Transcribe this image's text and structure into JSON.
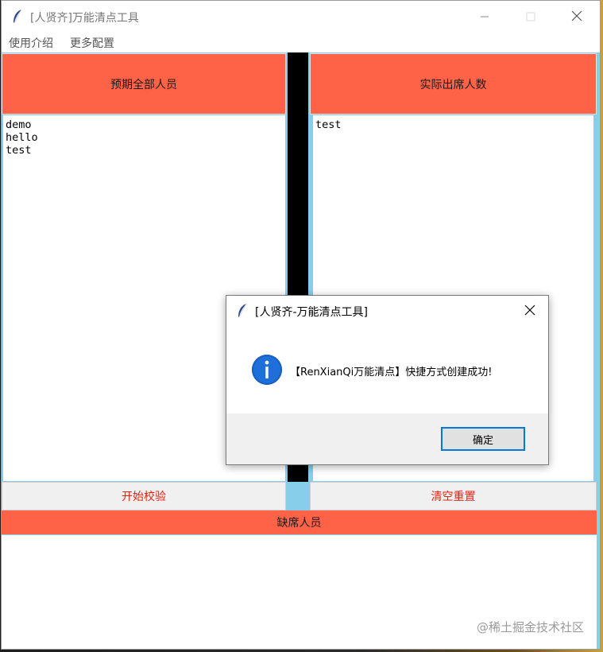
{
  "window": {
    "title": "[人贤齐]万能清点工具"
  },
  "menu": {
    "items": [
      "使用介绍",
      "更多配置"
    ]
  },
  "left_panel": {
    "header": "预期全部人员",
    "lines": "demo\nhello\ntest"
  },
  "right_panel": {
    "header": "实际出席人数",
    "lines": "test"
  },
  "buttons": {
    "start": "开始校验",
    "reset": "清空重置"
  },
  "absent": {
    "header": "缺席人员",
    "lines": ""
  },
  "dialog": {
    "title": "[人贤齐-万能清点工具]",
    "message": "【RenXianQi万能清点】快捷方式创建成功!",
    "ok_label": "确定"
  },
  "watermark": "@稀土掘金技术社区",
  "colors": {
    "header_bg": "#ff6347",
    "background": "#87ceeb",
    "divider": "#000000",
    "button_text": "#e8210f",
    "info_icon": "#1e6fd9"
  }
}
